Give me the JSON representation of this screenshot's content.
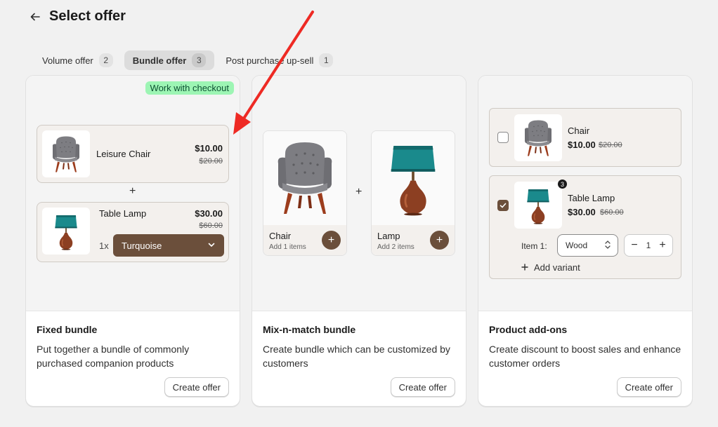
{
  "page": {
    "title": "Select offer"
  },
  "tabs": [
    {
      "label": "Volume offer",
      "count": "2"
    },
    {
      "label": "Bundle offer",
      "count": "3"
    },
    {
      "label": "Post purchase up-sell",
      "count": "1"
    }
  ],
  "cards": [
    {
      "title": "Fixed bundle",
      "description": "Put together a bundle of commonly purchased companion products",
      "button": "Create offer",
      "badge": "Work with checkout",
      "items": [
        {
          "name": "Leisure Chair",
          "price": "$10.00",
          "compare": "$20.00"
        },
        {
          "name": "Table Lamp",
          "price": "$30.00",
          "compare": "$60.00",
          "qty": "1x",
          "variant": "Turquoise"
        }
      ],
      "plus": "+"
    },
    {
      "title": "Mix-n-match bundle",
      "description": "Create bundle which can be customized by customers",
      "button": "Create offer",
      "plus": "+",
      "tiles": [
        {
          "name": "Chair",
          "sub": "Add 1 items",
          "add": "+"
        },
        {
          "name": "Lamp",
          "sub": "Add 2 items",
          "add": "+"
        }
      ]
    },
    {
      "title": "Product add-ons",
      "description": "Create discount to boost sales and enhance customer orders",
      "button": "Create offer",
      "addons": [
        {
          "name": "Chair",
          "price": "$10.00",
          "compare": "$20.00",
          "checked": false
        },
        {
          "name": "Table Lamp",
          "price": "$30.00",
          "compare": "$60.00",
          "checked": true,
          "badge": "3",
          "item_label": "Item 1:",
          "select_value": "Wood",
          "quantity": "1",
          "minus": "−",
          "plus": "+",
          "add_variant": "Add variant"
        }
      ]
    }
  ],
  "colors": {
    "accent_brown": "#6b4f3b",
    "badge_green": "#9df5b4",
    "annotation_arrow": "#ee2a24",
    "lamp_shade": "#1a8a8c",
    "lamp_base": "#8c3f22",
    "chair_fabric": "#7d7d82"
  },
  "icons": [
    "arrow-left-icon",
    "chevron-down-icon",
    "plus-icon",
    "checkmark-icon",
    "up-down-chevron-icon",
    "chair-image",
    "lamp-image",
    "red-annotation-arrow"
  ]
}
